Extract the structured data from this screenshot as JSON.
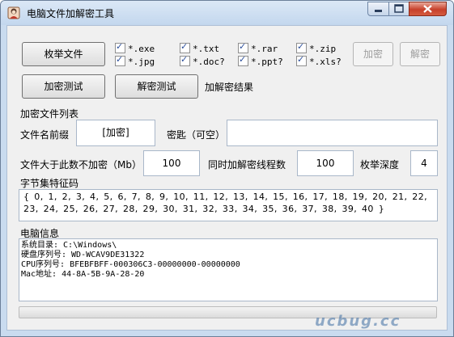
{
  "window": {
    "title": "电脑文件加解密工具"
  },
  "buttons": {
    "enumerate": "枚举文件",
    "encrypt_test": "加密测试",
    "decrypt_test": "解密测试",
    "encrypt": "加密",
    "decrypt": "解密"
  },
  "result_label": "加解密结果",
  "checkboxes": [
    {
      "label": "*.exe",
      "checked": true
    },
    {
      "label": "*.txt",
      "checked": true
    },
    {
      "label": "*.rar",
      "checked": true
    },
    {
      "label": "*.zip",
      "checked": true
    },
    {
      "label": "*.jpg",
      "checked": true
    },
    {
      "label": "*.doc?",
      "checked": true
    },
    {
      "label": "*.ppt?",
      "checked": true
    },
    {
      "label": "*.xls?",
      "checked": true
    }
  ],
  "encrypted_list": {
    "label": "加密文件列表"
  },
  "prefix": {
    "label": "文件名前缀",
    "value": "[加密]"
  },
  "key": {
    "label": "密匙（可空）",
    "value": ""
  },
  "size_limit": {
    "label": "文件大于此数不加密（Mb）",
    "value": "100"
  },
  "threads": {
    "label": "同时加解密线程数",
    "value": "100"
  },
  "depth": {
    "label": "枚举深度",
    "value": "4"
  },
  "charset": {
    "label": "字节集特征码",
    "value": "{ 0, 1, 2, 3, 4, 5, 6, 7, 8, 9, 10, 11, 12, 13, 14, 15, 16, 17, 18, 19, 20, 21, 22, 23, 24, 25, 26, 27, 28, 29, 30, 31, 32, 33, 34, 35, 36, 37, 38, 39, 40 }"
  },
  "computer_info": {
    "label": "电脑信息",
    "lines": [
      "系统目录: C:\\Windows\\",
      "硬盘序列号: WD-WCAV9DE31322",
      "CPU序列号: BFEBFBFF-000306C3-00000000-00000000",
      "Mac地址: 44-8A-5B-9A-28-20"
    ]
  },
  "progress": 0,
  "watermark": "ucbug.cc"
}
